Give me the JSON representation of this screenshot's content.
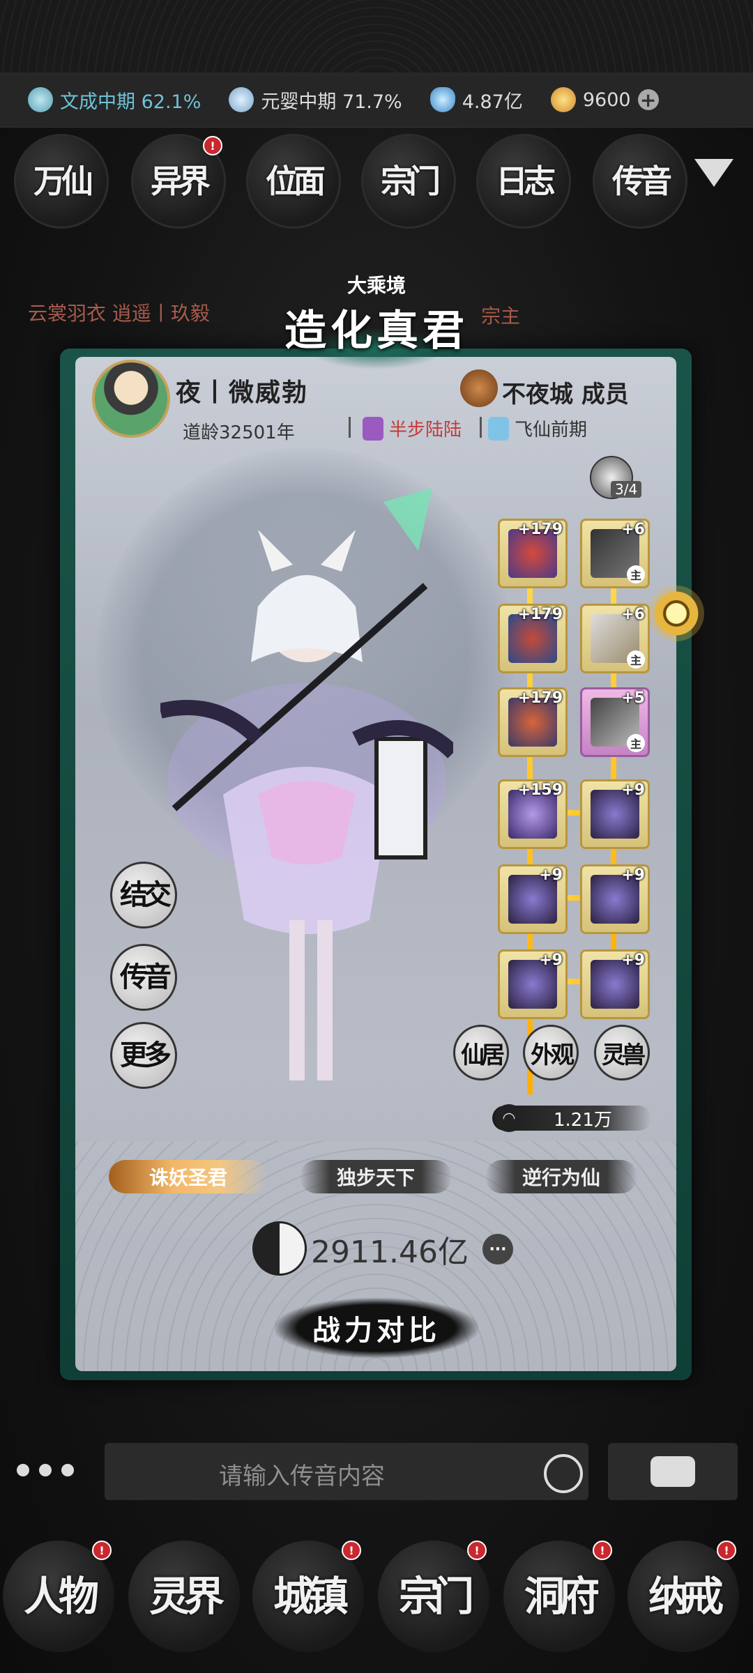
{
  "topbar": {
    "resources": [
      {
        "icon": "sword-icon",
        "value": "文成中期 62.1%",
        "accent": true
      },
      {
        "icon": "fan-icon",
        "value": "元婴中期 71.7%",
        "accent": false
      },
      {
        "icon": "spirit-stone-icon",
        "value": "4.87亿",
        "accent": false
      },
      {
        "icon": "coin-icon",
        "value": "9600",
        "accent": false
      }
    ],
    "plus": "+"
  },
  "topnav": {
    "items": [
      "万仙",
      "异界",
      "位面",
      "宗门",
      "日志",
      "传音"
    ]
  },
  "background_feed": {
    "line1": "云裳羽衣 逍遥丨玖毅",
    "line2": "宗主"
  },
  "profile": {
    "realm_small": "大乘境",
    "realm_big": "造化真君",
    "name": "夜丨微威勃",
    "age": "道龄32501年",
    "guild": "不夜城 成员",
    "half_step": "半步陆陆",
    "stage": "飞仙前期",
    "slot_count": "3/4"
  },
  "equipment": [
    {
      "level": "+179",
      "tag": ""
    },
    {
      "level": "+6",
      "tag": "主"
    },
    {
      "level": "+179",
      "tag": ""
    },
    {
      "level": "+6",
      "tag": "主"
    },
    {
      "level": "+179",
      "tag": ""
    },
    {
      "level": "+5",
      "tag": "主"
    },
    {
      "level": "+159",
      "tag": ""
    },
    {
      "level": "+9",
      "tag": ""
    },
    {
      "level": "+9",
      "tag": ""
    },
    {
      "level": "+9",
      "tag": ""
    },
    {
      "level": "+9",
      "tag": ""
    },
    {
      "level": "+9",
      "tag": ""
    }
  ],
  "actions_left": [
    "结交",
    "传音",
    "更多"
  ],
  "actions_right": [
    "仙居",
    "外观",
    "灵兽"
  ],
  "power_chip": "1.21万",
  "titles": [
    "诛妖圣君",
    "独步天下",
    "逆行为仙"
  ],
  "power_main": "2911.46亿",
  "more": "···",
  "compare": "战力对比",
  "chat": {
    "placeholder": "请输入传音内容"
  },
  "bottomnav": {
    "items": [
      "人物",
      "灵界",
      "城镇",
      "宗门",
      "洞府",
      "纳戒"
    ]
  },
  "colors": {
    "accent": "#6fc3d9",
    "badge": "#c9282f",
    "frame": "#1a5448",
    "gold": "#f3b768"
  }
}
